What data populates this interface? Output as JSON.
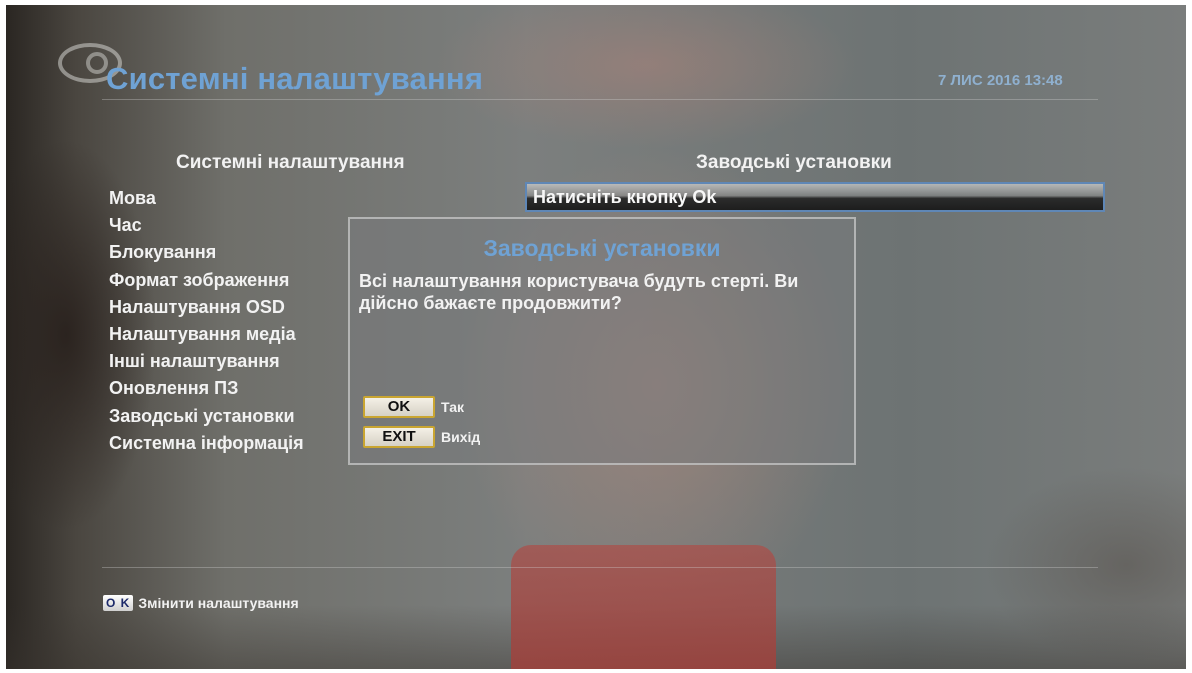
{
  "header": {
    "title": "Системні налаштування",
    "datetime": "7 ЛИС 2016 13:48"
  },
  "left_panel": {
    "heading": "Системні налаштування",
    "items": [
      {
        "label": "Мова"
      },
      {
        "label": "Час"
      },
      {
        "label": "Блокування"
      },
      {
        "label": "Формат зображення"
      },
      {
        "label": "Налаштування OSD"
      },
      {
        "label": "Налаштування медіа"
      },
      {
        "label": "Інші налаштування"
      },
      {
        "label": "Оновлення ПЗ"
      },
      {
        "label": "Заводські установки",
        "selected": true
      },
      {
        "label": "Системна інформація"
      }
    ]
  },
  "right_panel": {
    "heading": "Заводські установки",
    "value": "Натисніть кнопку Ok"
  },
  "dialog": {
    "title": "Заводські установки",
    "message": "Всі налаштування користувача будуть стерті. Ви дійсно бажаєте продовжити?",
    "ok_key": "OK",
    "ok_label": "Так",
    "exit_key": "EXIT",
    "exit_label": "Вихід"
  },
  "footer": {
    "key": "O K",
    "hint": "Змінити налаштування"
  },
  "colors": {
    "title_blue": "#6fa2d4",
    "selection_border": "#5f87b6",
    "key_border": "#c9a531"
  }
}
